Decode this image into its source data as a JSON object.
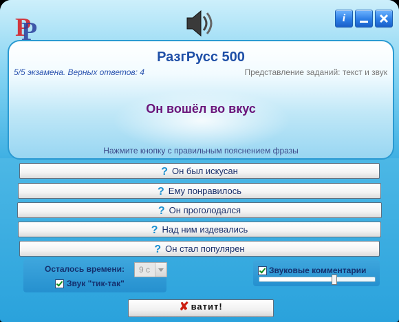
{
  "app": {
    "title": "РазгРусс 500",
    "window_buttons": {
      "info": "i"
    }
  },
  "status": {
    "progress": "5/5 экзамена. Верных ответов: 4",
    "mode": "Представление заданий: текст и звук"
  },
  "task": {
    "phrase": "Он вошёл во вкус",
    "instruction": "Нажмите кнопку с правильным пояснением фразы"
  },
  "answers": [
    {
      "label": "Он был искусан"
    },
    {
      "label": "Ему понравилось"
    },
    {
      "label": "Он проголодался"
    },
    {
      "label": "Над ним издевались"
    },
    {
      "label": "Он стал популярен"
    }
  ],
  "icons": {
    "answer": "question-mark-icon",
    "quit": "red-x-icon",
    "speaker": "speaker-icon",
    "logo": "pr-logo"
  },
  "timer": {
    "label": "Осталось времени:",
    "value": "9 с",
    "tick_label": "Звук \"тик-так\"",
    "tick_checked": true
  },
  "sound": {
    "comments_label": "Звуковые комментарии",
    "comments_checked": true,
    "volume_fraction": 0.64
  },
  "quit": {
    "label": "ватит!"
  },
  "colors": {
    "accent": "#1f4fa7",
    "phrase": "#6b157a",
    "question_mark": "#1a8fd0",
    "quit_x": "#cc1d10"
  }
}
